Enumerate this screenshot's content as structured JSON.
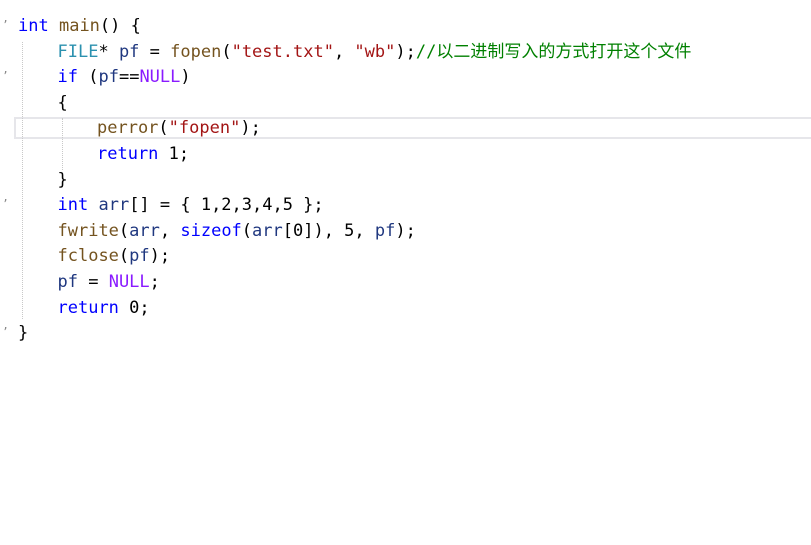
{
  "editor": {
    "lines": [
      {
        "indent": 0,
        "tokens": [
          {
            "t": "int",
            "c": "kw"
          },
          {
            "t": " ",
            "c": "pun"
          },
          {
            "t": "main",
            "c": "fn"
          },
          {
            "t": "() {",
            "c": "pun"
          }
        ]
      },
      {
        "indent": 1,
        "tokens": [
          {
            "t": "FILE",
            "c": "type"
          },
          {
            "t": "* ",
            "c": "pun"
          },
          {
            "t": "pf",
            "c": "var"
          },
          {
            "t": " = ",
            "c": "pun"
          },
          {
            "t": "fopen",
            "c": "fn"
          },
          {
            "t": "(",
            "c": "pun"
          },
          {
            "t": "\"test.txt\"",
            "c": "str"
          },
          {
            "t": ", ",
            "c": "pun"
          },
          {
            "t": "\"wb\"",
            "c": "str"
          },
          {
            "t": ");",
            "c": "pun"
          },
          {
            "t": "//以二进制写入的方式打开这个文件",
            "c": "cmt"
          }
        ]
      },
      {
        "indent": 1,
        "tokens": [
          {
            "t": "if",
            "c": "kw"
          },
          {
            "t": " (",
            "c": "pun"
          },
          {
            "t": "pf",
            "c": "var"
          },
          {
            "t": "==",
            "c": "pun"
          },
          {
            "t": "NULL",
            "c": "macro"
          },
          {
            "t": ")",
            "c": "pun"
          }
        ]
      },
      {
        "indent": 1,
        "tokens": [
          {
            "t": "{",
            "c": "pun"
          }
        ]
      },
      {
        "indent": 2,
        "tokens": [
          {
            "t": "perror",
            "c": "fn"
          },
          {
            "t": "(",
            "c": "pun"
          },
          {
            "t": "\"fopen\"",
            "c": "str"
          },
          {
            "t": ");",
            "c": "pun"
          }
        ]
      },
      {
        "indent": 2,
        "tokens": [
          {
            "t": "return",
            "c": "kw"
          },
          {
            "t": " 1;",
            "c": "pun"
          }
        ]
      },
      {
        "indent": 1,
        "tokens": [
          {
            "t": "}",
            "c": "pun"
          }
        ]
      },
      {
        "indent": 1,
        "tokens": [
          {
            "t": "int",
            "c": "kw"
          },
          {
            "t": " ",
            "c": "pun"
          },
          {
            "t": "arr",
            "c": "var"
          },
          {
            "t": "[] = { 1,2,3,4,5 };",
            "c": "pun"
          }
        ]
      },
      {
        "indent": 1,
        "tokens": [
          {
            "t": "fwrite",
            "c": "fn"
          },
          {
            "t": "(",
            "c": "pun"
          },
          {
            "t": "arr",
            "c": "var"
          },
          {
            "t": ", ",
            "c": "pun"
          },
          {
            "t": "sizeof",
            "c": "kw"
          },
          {
            "t": "(",
            "c": "pun"
          },
          {
            "t": "arr",
            "c": "var"
          },
          {
            "t": "[0]), 5, ",
            "c": "pun"
          },
          {
            "t": "pf",
            "c": "var"
          },
          {
            "t": ");",
            "c": "pun"
          }
        ]
      },
      {
        "indent": 1,
        "tokens": [
          {
            "t": "fclose",
            "c": "fn"
          },
          {
            "t": "(",
            "c": "pun"
          },
          {
            "t": "pf",
            "c": "var"
          },
          {
            "t": ");",
            "c": "pun"
          }
        ]
      },
      {
        "indent": 1,
        "tokens": [
          {
            "t": "pf",
            "c": "var"
          },
          {
            "t": " = ",
            "c": "pun"
          },
          {
            "t": "NULL",
            "c": "macro"
          },
          {
            "t": ";",
            "c": "pun"
          }
        ]
      },
      {
        "indent": 1,
        "tokens": [
          {
            "t": "return",
            "c": "kw"
          },
          {
            "t": " 0;",
            "c": "pun"
          }
        ]
      },
      {
        "indent": 0,
        "tokens": [
          {
            "t": "}",
            "c": "pun"
          }
        ]
      }
    ],
    "current_line_index": 4,
    "collapse_markers": [
      0,
      2,
      7,
      12
    ]
  }
}
